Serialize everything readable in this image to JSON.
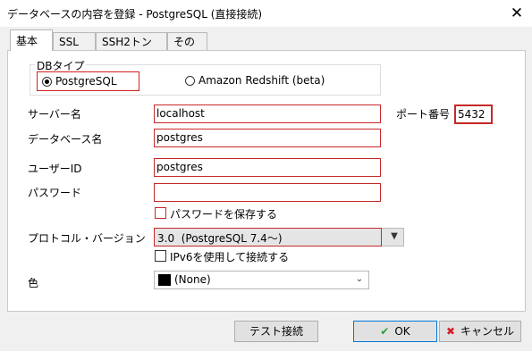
{
  "window": {
    "title": "データベースの内容を登録 - PostgreSQL (直接接続)",
    "close_glyph": "✕"
  },
  "tabs": [
    {
      "label": "基本",
      "active": true
    },
    {
      "label": "SSL",
      "active": false
    },
    {
      "label": "SSH2トンネル",
      "active": false
    },
    {
      "label": "その他",
      "active": false
    }
  ],
  "db_type": {
    "legend": "DBタイプ",
    "options": [
      {
        "label": "PostgreSQL",
        "selected": true
      },
      {
        "label": "Amazon Redshift (beta)",
        "selected": false
      }
    ]
  },
  "form": {
    "server_label": "サーバー名",
    "server_value": "localhost",
    "port_label": "ポート番号",
    "port_value": "5432",
    "database_label": "データベース名",
    "database_value": "postgres",
    "user_label": "ユーザーID",
    "user_value": "postgres",
    "password_label": "パスワード",
    "password_value": "",
    "save_password_label": "パスワードを保存する",
    "protocol_label": "プロトコル・バージョン",
    "protocol_value": "3.0  (PostgreSQL 7.4〜)",
    "ipv6_label": "IPv6を使用して接続する",
    "color_label": "色",
    "color_value": "(None)",
    "color_swatch": "#000000"
  },
  "buttons": {
    "test_label": "テスト接続",
    "ok_label": "OK",
    "ok_icon": "✔",
    "ok_icon_color": "#2e9e3a",
    "cancel_label": "キャンセル",
    "cancel_icon": "✖",
    "cancel_icon_color": "#d0202a"
  },
  "colors": {
    "highlight": "#c62828"
  }
}
